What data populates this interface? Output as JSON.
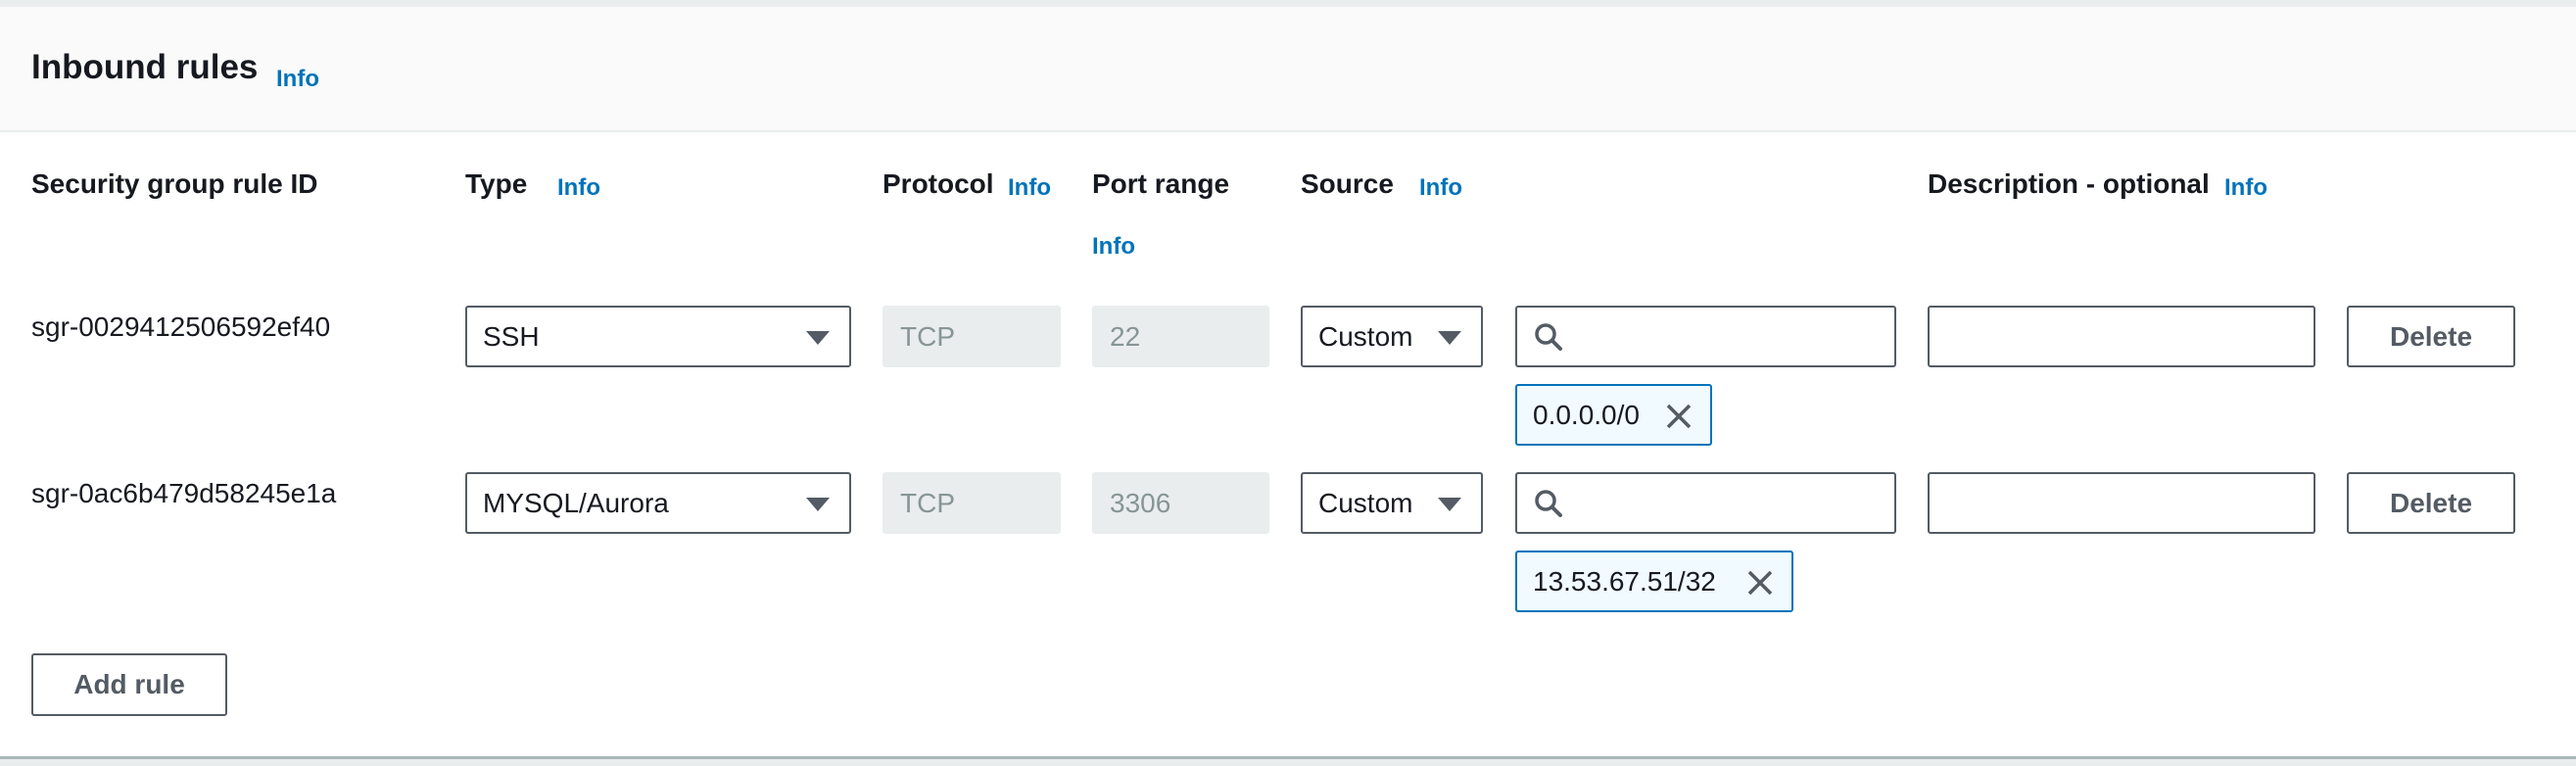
{
  "header": {
    "title": "Inbound rules",
    "info": "Info"
  },
  "columns": {
    "rule_id": "Security group rule ID",
    "type": "Type",
    "type_info": "Info",
    "protocol": "Protocol",
    "protocol_info": "Info",
    "port_range": "Port range",
    "port_range_info": "Info",
    "source": "Source",
    "source_info": "Info",
    "description": "Description - optional",
    "description_info": "Info"
  },
  "rules": [
    {
      "id": "sgr-0029412506592ef40",
      "type": "SSH",
      "protocol": "TCP",
      "port_range": "22",
      "source_type": "Custom",
      "source_search": "",
      "source_token": "0.0.0.0/0",
      "description": "",
      "delete_label": "Delete"
    },
    {
      "id": "sgr-0ac6b479d58245e1a",
      "type": "MYSQL/Aurora",
      "protocol": "TCP",
      "port_range": "3306",
      "source_type": "Custom",
      "source_search": "",
      "source_token": "13.53.67.51/32",
      "description": "",
      "delete_label": "Delete"
    }
  ],
  "add_rule_label": "Add rule",
  "colors": {
    "accent": "#0073bb",
    "border": "#545b64",
    "disabled_bg": "#eaeded",
    "token_bg": "#f1faff"
  }
}
